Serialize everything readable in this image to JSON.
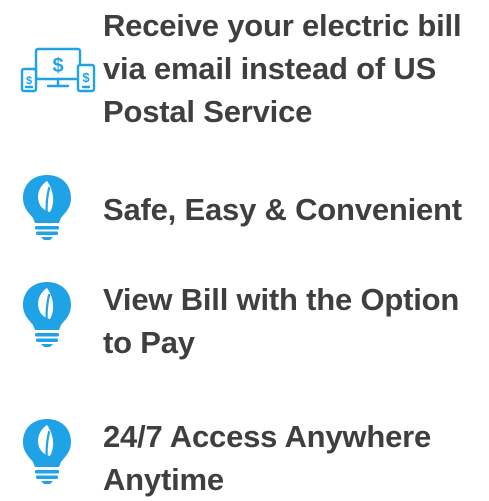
{
  "accent_color": "#1fa3e6",
  "text_color": "#3f3f3f",
  "features": [
    {
      "icon": "ebill-devices-icon",
      "text": "Receive your electric bill via email instead of US Postal Service"
    },
    {
      "icon": "leaf-lightbulb-icon",
      "text": "Safe, Easy & Convenient"
    },
    {
      "icon": "leaf-lightbulb-icon",
      "text": "View Bill with the Option to Pay"
    },
    {
      "icon": "leaf-lightbulb-icon",
      "text": "24/7 Access Anywhere Anytime"
    }
  ]
}
